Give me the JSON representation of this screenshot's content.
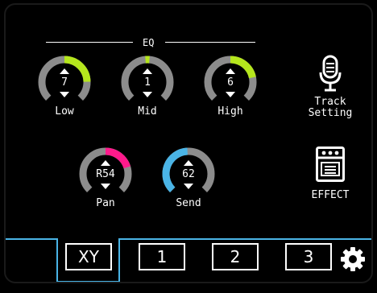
{
  "eq": {
    "title": "EQ",
    "knobs": [
      {
        "id": "low",
        "value": "7",
        "label": "Low",
        "level": 0.83,
        "color": "#b5e61d"
      },
      {
        "id": "mid",
        "value": "1",
        "label": "Mid",
        "level": 0.5,
        "color": "#b5e61d"
      },
      {
        "id": "high",
        "value": "6",
        "label": "High",
        "level": 0.79,
        "color": "#b5e61d"
      }
    ]
  },
  "mix": {
    "knobs": [
      {
        "id": "pan",
        "value": "R54",
        "label": "Pan",
        "level": 0.77,
        "color": "#ff1a8c"
      },
      {
        "id": "send",
        "value": "62",
        "label": "Send",
        "level": 0.49,
        "color": "#4ab4e6"
      }
    ]
  },
  "side": {
    "track_setting_line1": "Track",
    "track_setting_line2": "Setting",
    "effect_label": "EFFECT"
  },
  "tabs": [
    "XY",
    "1",
    "2",
    "3"
  ],
  "icons": {
    "mic": "microphone-icon",
    "effect": "effect-box-icon",
    "settings": "gear-icon"
  },
  "colors": {
    "accent_blue": "#4ab4e6",
    "knob_track": "#8c8c8c",
    "eq_green": "#b5e61d",
    "pan_pink": "#ff1a8c"
  }
}
